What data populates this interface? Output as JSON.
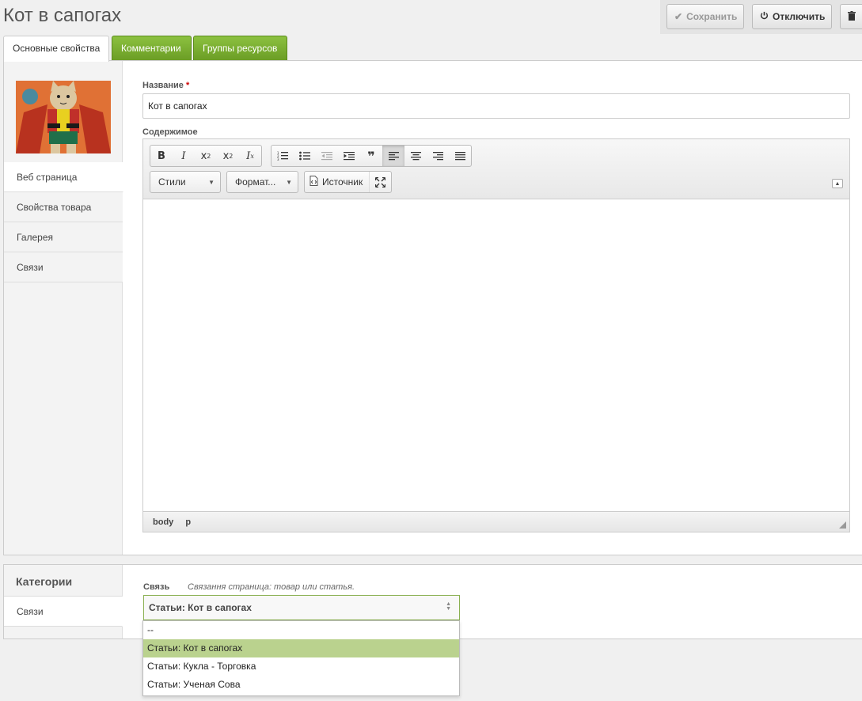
{
  "page": {
    "title": "Кот в сапогах"
  },
  "actions": {
    "save": "Сохранить",
    "disable": "Отключить"
  },
  "tabs": [
    {
      "label": "Основные свойства",
      "active": true
    },
    {
      "label": "Комментарии",
      "active": false
    },
    {
      "label": "Группы ресурсов",
      "active": false
    }
  ],
  "sidebar": {
    "items": [
      {
        "label": "Веб страница",
        "active": true
      },
      {
        "label": "Свойства товара",
        "active": false
      },
      {
        "label": "Галерея",
        "active": false
      },
      {
        "label": "Связи",
        "active": false
      }
    ]
  },
  "form": {
    "name_label": "Название",
    "required_mark": "*",
    "name_value": "Кот в сапогах",
    "content_label": "Содержимое"
  },
  "editor": {
    "styles_combo": "Стили",
    "format_combo": "Формат...",
    "source_button": "Источник",
    "status_path": [
      "body",
      "p"
    ]
  },
  "bottom": {
    "categories_header": "Категории",
    "link_item": "Связи",
    "link_label": "Связь",
    "link_hint": "Связання страница: товар или статья.",
    "select_value": "Статьи: Кот в сапогах",
    "options": [
      {
        "label": "--",
        "selected": false
      },
      {
        "label": "Статьи: Кот в сапогах",
        "selected": true
      },
      {
        "label": "Статьи: Кукла - Торговка",
        "selected": false
      },
      {
        "label": "Статьи: Ученая Сова",
        "selected": false
      }
    ]
  },
  "colors": {
    "tab_green": "#7aab32",
    "selection_green": "#bad28e",
    "required_red": "#cc0000"
  }
}
